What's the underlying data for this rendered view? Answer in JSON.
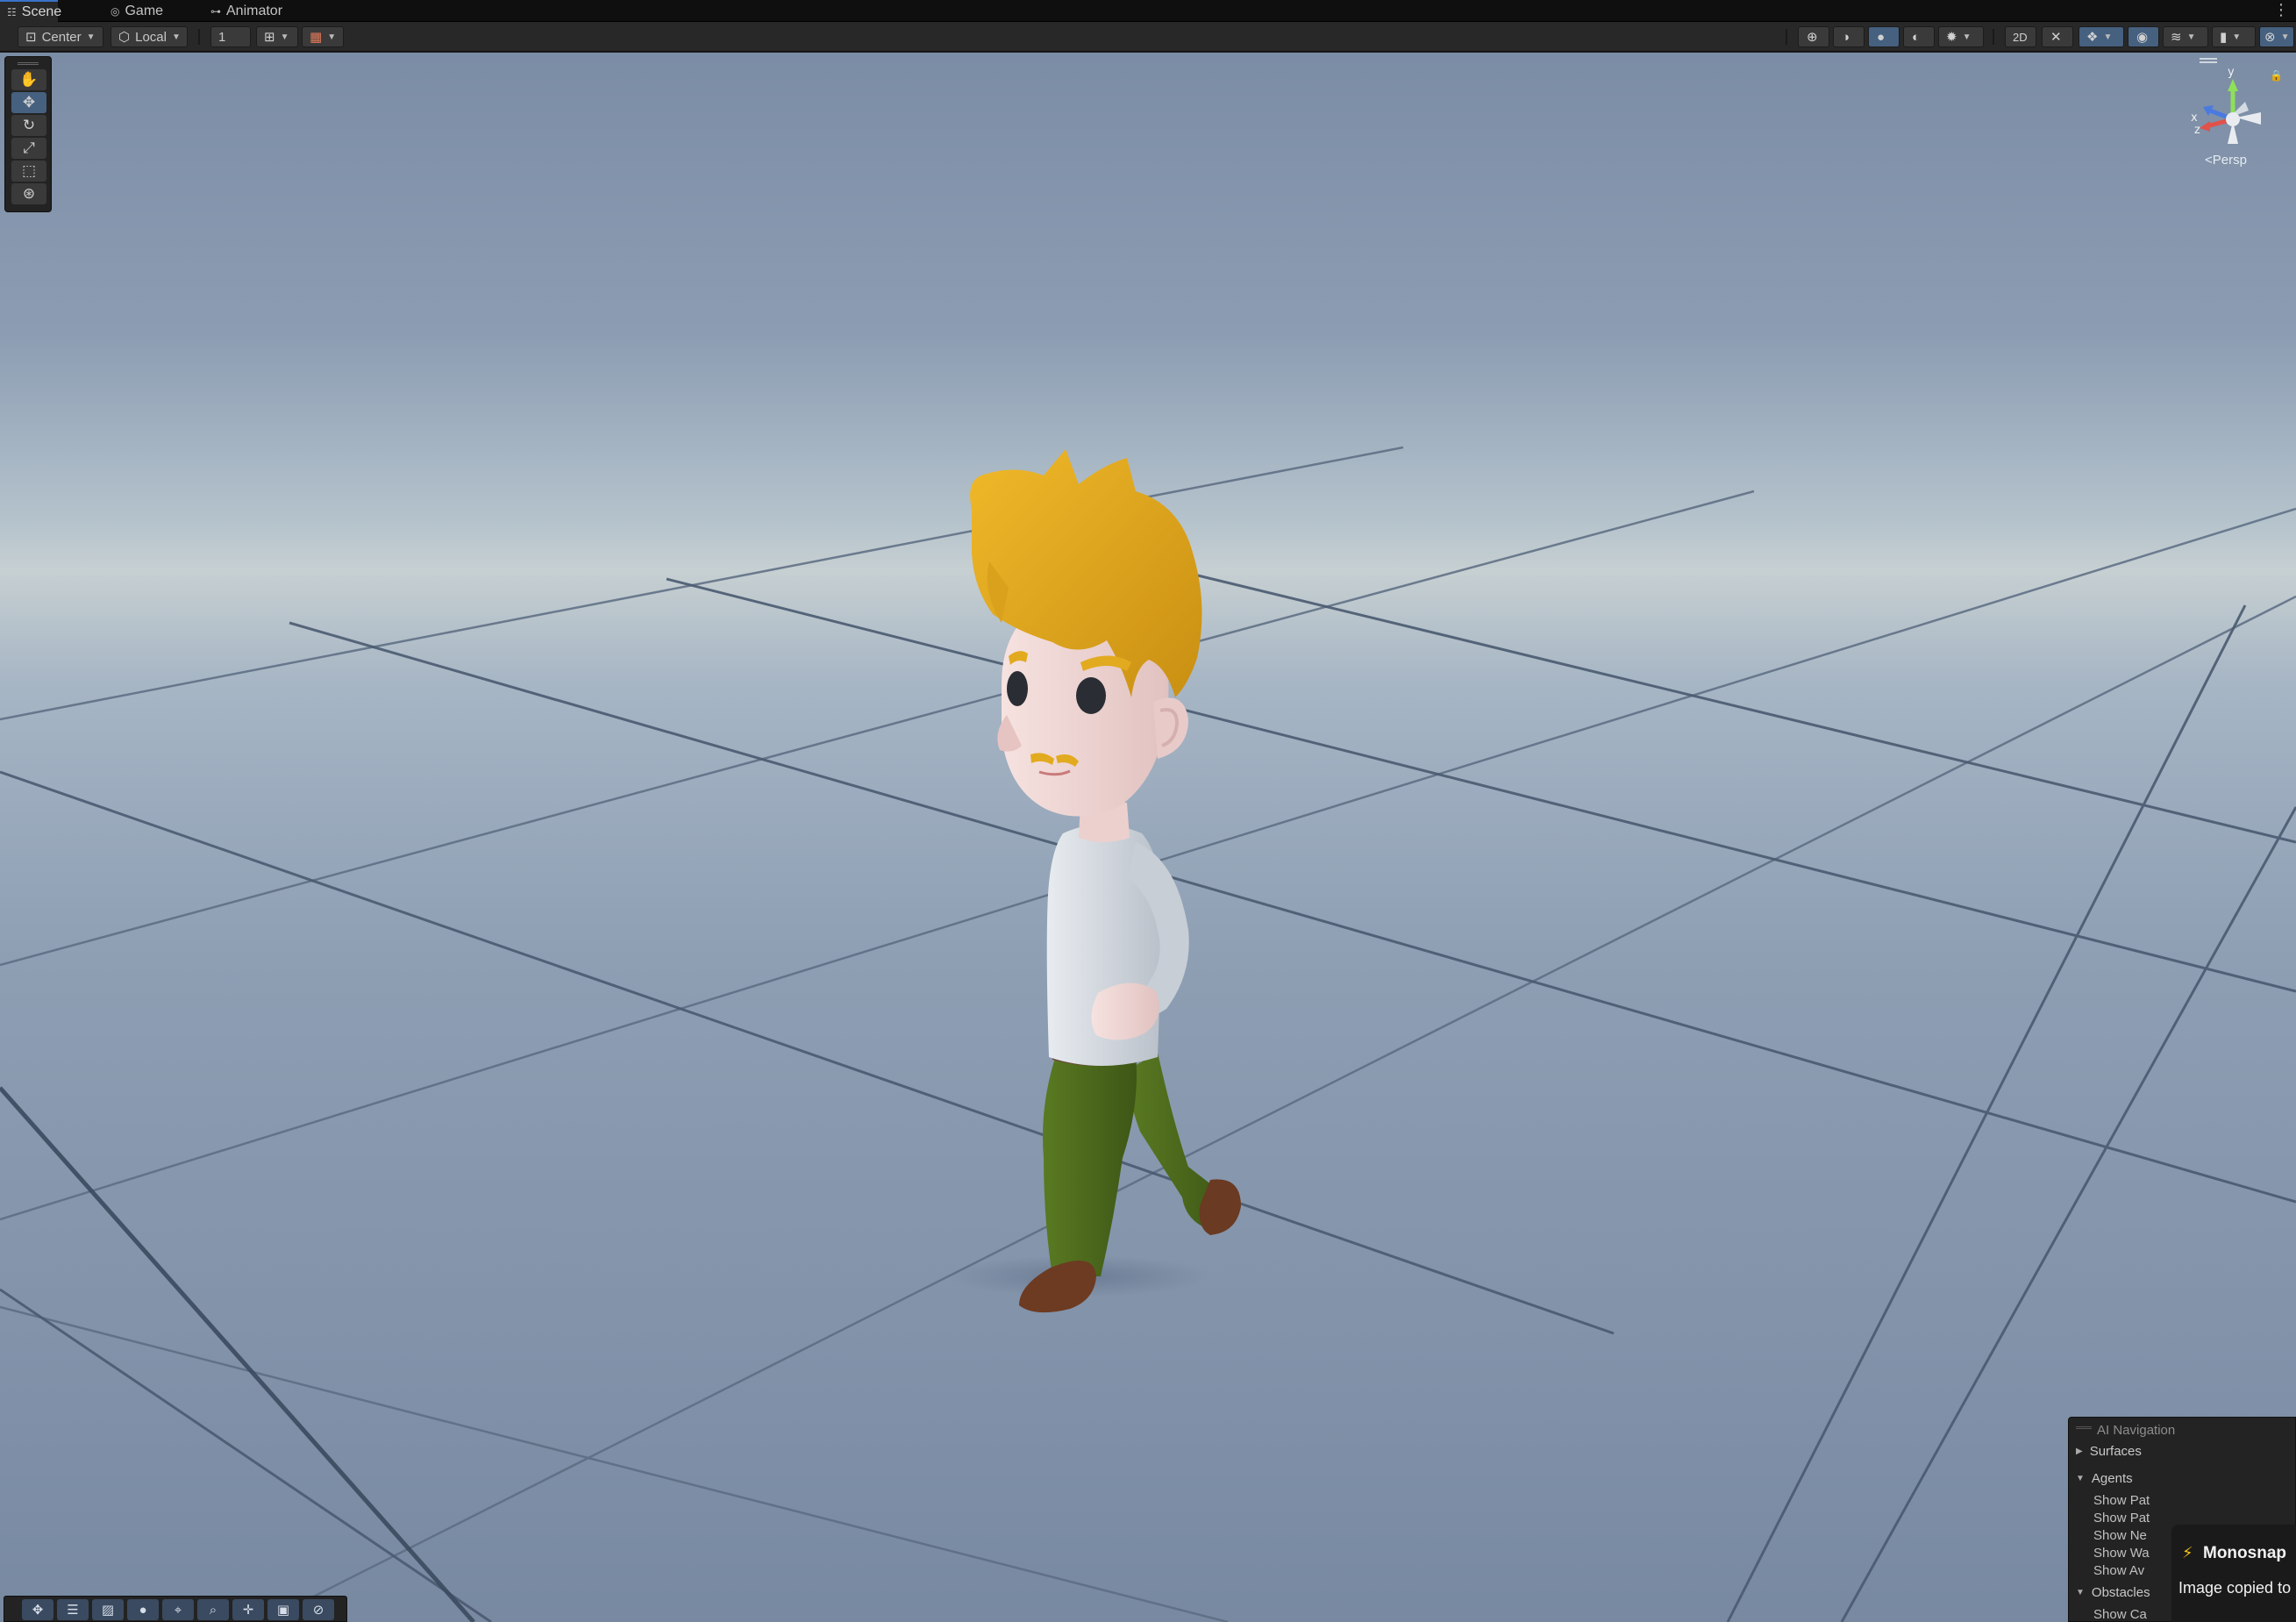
{
  "tabs": [
    {
      "label": "Scene",
      "icon": "scene-grid-icon",
      "active": true
    },
    {
      "label": "Game",
      "icon": "gamepad-icon",
      "active": false
    },
    {
      "label": "Animator",
      "icon": "animator-icon",
      "active": false
    }
  ],
  "toolbar": {
    "pivot_mode": "Center",
    "pivot_rotation": "Local",
    "grid_size": "1"
  },
  "scene": {
    "projection_label": "Persp",
    "gizmo_axes": {
      "y": "y",
      "x": "x",
      "z": "z"
    }
  },
  "ai_navigation": {
    "title": "AI Navigation",
    "sections": {
      "surfaces": "Surfaces",
      "agents": "Agents",
      "obstacles": "Obstacles"
    },
    "agent_items": [
      "Show Pat",
      "Show Pat",
      "Show Ne",
      "Show Wa",
      "Show Av"
    ],
    "obstacle_items": [
      "Show Ca"
    ]
  },
  "toast": {
    "app_name": "Monosnap",
    "message": "Image copied to"
  },
  "colors": {
    "accent": "#46607f",
    "hair": "#e2aa1f",
    "skin": "#f1d8d6",
    "shirt": "#d9dee3",
    "pants": "#4f6a1f",
    "shoes": "#6a3a22"
  }
}
